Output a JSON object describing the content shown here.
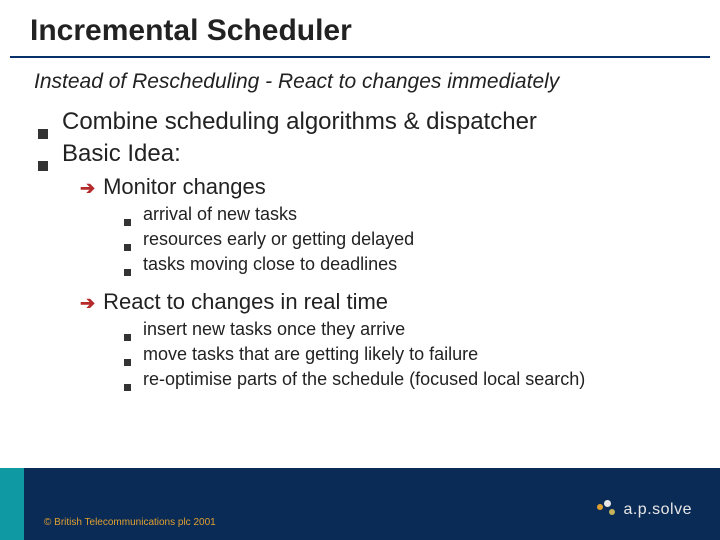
{
  "title": "Incremental Scheduler",
  "subtitle": "Instead of Rescheduling - React to changes immediately",
  "bullets": {
    "l1": [
      "Combine scheduling algorithms & dispatcher",
      "Basic Idea:"
    ],
    "sec1": {
      "heading": "Monitor changes",
      "items": [
        "arrival of new tasks",
        "resources early or getting delayed",
        "tasks moving close to deadlines"
      ]
    },
    "sec2": {
      "heading": "React to changes in real time",
      "items": [
        "insert new tasks once they arrive",
        "move tasks that are getting likely to failure",
        "re-optimise parts of the schedule (focused local search)"
      ]
    }
  },
  "footer": {
    "copyright": "© British Telecommunications plc 2001",
    "logo_text": "a.p.solve"
  },
  "colors": {
    "footer_bg": "#0a2b56",
    "teal": "#0f9aa3",
    "accent_arrow": "#b52a2a",
    "gold": "#e0a030"
  }
}
